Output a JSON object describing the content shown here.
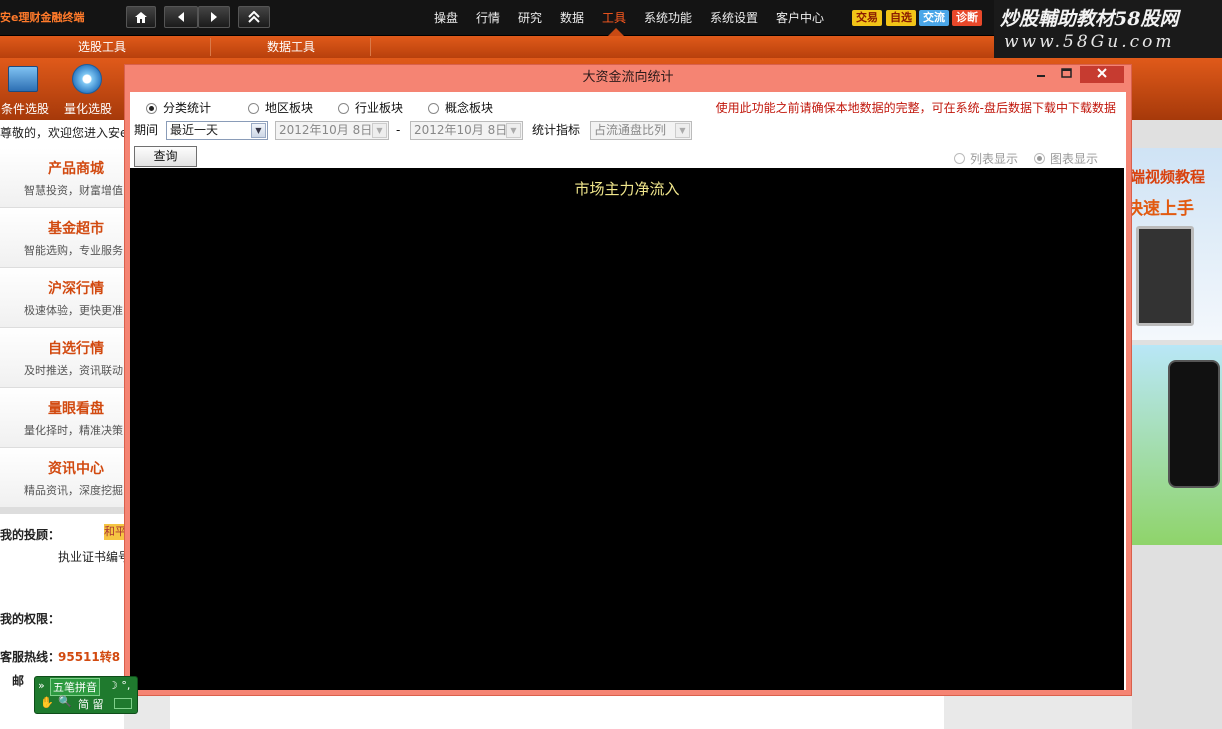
{
  "app": {
    "logo_text": "安e理财金融终端",
    "home_icon": "home-icon",
    "nav_back_icon": "back-icon",
    "nav_forward_icon": "forward-icon",
    "collapse_icon": "collapse-up-icon"
  },
  "menu": {
    "items": [
      "操盘",
      "行情",
      "研究",
      "数据",
      "工具",
      "系统功能",
      "系统设置",
      "客户中心"
    ],
    "active": "工具"
  },
  "quick_buttons": [
    {
      "label": "交易",
      "bg": "#f2c418",
      "fg": "#8a1a00"
    },
    {
      "label": "自选",
      "bg": "#f2c418",
      "fg": "#8a1a00"
    },
    {
      "label": "交流",
      "bg": "#4aa6e8",
      "fg": "#ffffff"
    },
    {
      "label": "诊断",
      "bg": "#e8482a",
      "fg": "#ffffff"
    }
  ],
  "watermark": {
    "line1": "炒股輔助教材58股网",
    "line2": "www.58Gu.com"
  },
  "subtabs": [
    "选股工具",
    "数据工具"
  ],
  "tools": [
    {
      "label": "条件选股",
      "icon": "screen-stock-icon"
    },
    {
      "label": "量化选股",
      "icon": "quant-disc-icon"
    }
  ],
  "left_panel": {
    "welcome": "尊敬的，欢迎您进入安e",
    "items": [
      {
        "title": "产品商城",
        "sub": "智慧投资，财富增值"
      },
      {
        "title": "基金超市",
        "sub": "智能选购，专业服务"
      },
      {
        "title": "沪深行情",
        "sub": "极速体验，更快更准"
      },
      {
        "title": "自选行情",
        "sub": "及时推送，资讯联动"
      },
      {
        "title": "量眼看盘",
        "sub": "量化择时，精准决策"
      },
      {
        "title": "资讯中心",
        "sub": "精品资讯，深度挖掘"
      }
    ],
    "advisor_label": "我的投顾：",
    "advisor_badge": "和平",
    "license_label": "执业证书编号",
    "permission_label": "我的权限：",
    "hotline_label": "客服热线：",
    "hotline_value": "95511转8",
    "mail_label": "邮"
  },
  "right_panel": {
    "promo_line1": "端视频教程",
    "promo_line2": "快速上手"
  },
  "dialog": {
    "title": "大资金流向统计",
    "minimize_icon": "minimize-icon",
    "maximize_icon": "maximize-icon",
    "close_icon": "close-icon",
    "radios": [
      {
        "label": "分类统计",
        "checked": true
      },
      {
        "label": "地区板块",
        "checked": false
      },
      {
        "label": "行业板块",
        "checked": false
      },
      {
        "label": "概念板块",
        "checked": false
      }
    ],
    "warning": "使用此功能之前请确保本地数据的完整，可在系统-盘后数据下载中下载数据",
    "period_label": "期间",
    "period_value": "最近一天",
    "date_from": "2012年10月 8日,",
    "date_sep": "-",
    "date_to": "2012年10月 8日,",
    "stat_label": "统计指标",
    "stat_value": "占流通盘比列",
    "query_label": "查询",
    "view_list": "列表显示",
    "view_chart": "图表显示",
    "chart_title": "市场主力净流入"
  },
  "ime": {
    "mode": "五笔拼音",
    "row2": "简 留"
  }
}
